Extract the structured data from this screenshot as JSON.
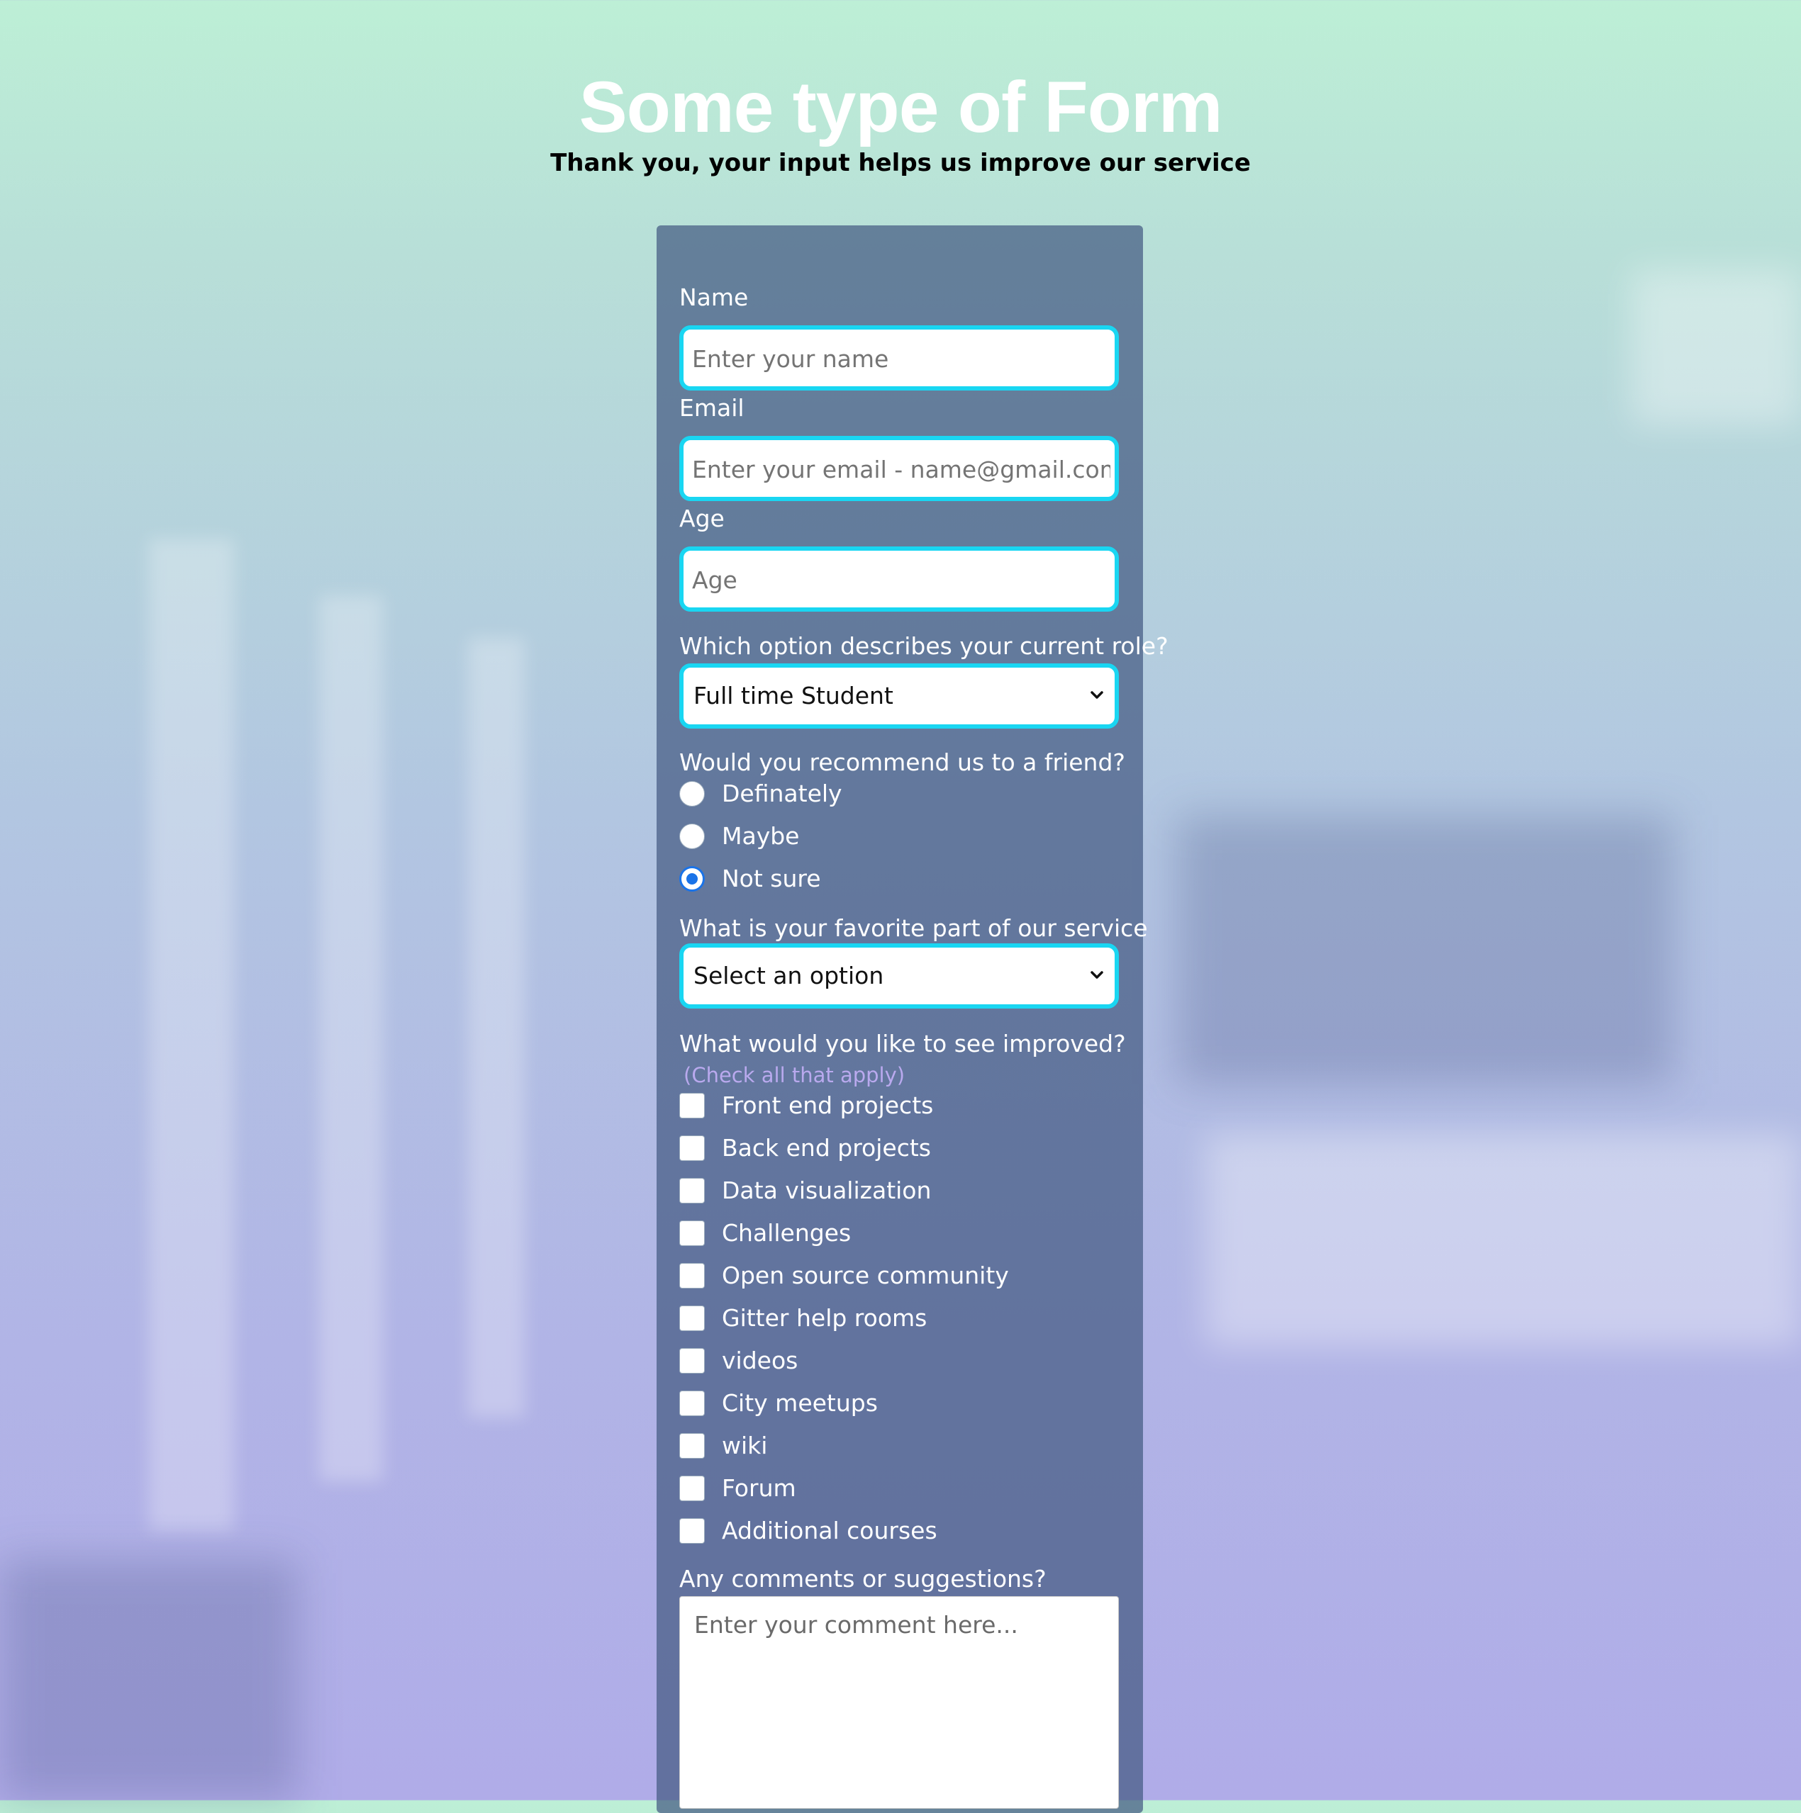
{
  "header": {
    "title": "Some type of Form",
    "subtitle": "Thank you, your input helps us improve our service"
  },
  "form": {
    "name": {
      "label": "Name",
      "placeholder": "Enter your name",
      "value": ""
    },
    "email": {
      "label": "Email",
      "placeholder": "Enter your email - name@gmail.com",
      "value": ""
    },
    "age": {
      "label": "Age",
      "placeholder": "Age",
      "value": ""
    },
    "role": {
      "label": "Which option describes your current role?",
      "selected": "Full time Student"
    },
    "recommend": {
      "label": "Would you recommend us to a friend?",
      "options": [
        "Definately",
        "Maybe",
        "Not sure"
      ],
      "selected_index": 2
    },
    "favorite": {
      "label": "What is your favorite part of our service",
      "selected": "Select an option"
    },
    "improve": {
      "label": "What would you like to see improved?",
      "hint": "(Check all that apply)",
      "options": [
        "Front end projects",
        "Back end projects",
        "Data visualization",
        "Challenges",
        "Open source community",
        "Gitter help rooms",
        "videos",
        "City meetups",
        "wiki",
        "Forum",
        "Additional courses"
      ],
      "checked": []
    },
    "comments": {
      "label": "Any comments or suggestions?",
      "placeholder": "Enter your comment here..."
    }
  },
  "colors": {
    "accent_border": "#19d6f2",
    "radio_selected": "#1a73e8",
    "card_background": "#445a82",
    "hint_text": "#b9a9ee"
  },
  "icons": {
    "select_indicator": "chevron-down-icon"
  }
}
